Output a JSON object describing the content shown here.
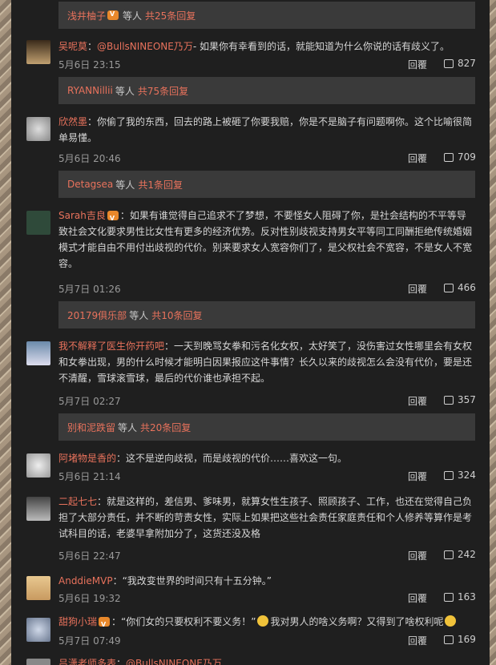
{
  "reply_bars": [
    {
      "user": "浅井柚子",
      "others": "等人",
      "count": "共25条回复"
    },
    {
      "user": "RYANNillii",
      "others": "等人",
      "count": "共75条回复"
    },
    {
      "user": "Detagsea",
      "others": "等人",
      "count": "共1条回复"
    },
    {
      "user": "20179俱乐部",
      "others": "等人",
      "count": "共10条回复"
    },
    {
      "user": "别和泥跌留",
      "others": "等人",
      "count": "共20条回复"
    }
  ],
  "comments": [
    {
      "user": "吴呢莫",
      "mention": "@BullsNINEONE乃万",
      "text": "- 如果你有幸看到的话，就能知道为什么你说的话有歧义了。",
      "time": "5月6日 23:15",
      "reply": "回覆",
      "likes": "827"
    },
    {
      "user": "欣然墨",
      "text": "你偷了我的东西，回去的路上被砸了你要我赔，你是不是脑子有问题啊你。这个比喻很简单易懂。",
      "time": "5月6日 20:46",
      "reply": "回覆",
      "likes": "709"
    },
    {
      "user": "Sarah吉良",
      "text": "如果有谁觉得自己追求不了梦想，不要怪女人阻碍了你，是社会结构的不平等导致社会文化要求男性比女性有更多的经济优势。反对性别歧视支持男女平等同工同酬拒绝传统婚姻模式才能自由不用付出歧视的代价。别来要求女人宽容你们了，是父权社会不宽容，不是女人不宽容。",
      "time": "5月7日 01:26",
      "reply": "回覆",
      "likes": "466"
    },
    {
      "user": "我不解释了医生你开药吧",
      "text": "一天到晚骂女拳和污名化女权，太好笑了，没伤害过女性哪里会有女权和女拳出现，男的什么时候才能明白因果报应这件事情？长久以来的歧视怎么会没有代价，要是还不清醒，雪球滚雪球，最后的代价谁也承担不起。",
      "time": "5月7日 02:27",
      "reply": "回覆",
      "likes": "357"
    },
    {
      "user": "阿堵物是香的",
      "text": "这不是逆向歧视，而是歧视的代价……喜欢这一句。",
      "time": "5月6日 21:14",
      "reply": "回覆",
      "likes": "324"
    },
    {
      "user": "二起七七",
      "text": "就是这样的，差信男、爹味男，就算女性生孩子、照顾孩子、工作，也还在觉得自己负担了大部分责任，并不断的苛责女性，实际上如果把这些社会责任家庭责任和个人修养等算作是考试科目的话，老婆早拿附加分了，这货还没及格",
      "time": "5月6日 22:47",
      "reply": "回覆",
      "likes": "242"
    },
    {
      "user": "AnddieMVP",
      "text": "“我改变世界的时间只有十五分钟。”",
      "time": "5月6日 19:32",
      "reply": "回覆",
      "likes": "163"
    },
    {
      "user": "甜狗小瑞",
      "text": "“你们女的只要权利不要义务！”",
      "text2": "我对男人的啥义务啊？又得到了啥权利呢",
      "time": "5月7日 07:49",
      "reply": "回覆",
      "likes": "169"
    },
    {
      "user": "吕潇老师多表",
      "mention": "@BullsNINEONE乃万"
    }
  ],
  "colors": {
    "username": "#e8725c",
    "panel": "#1f1f1f",
    "reply_bar": "#3a3a3a"
  }
}
